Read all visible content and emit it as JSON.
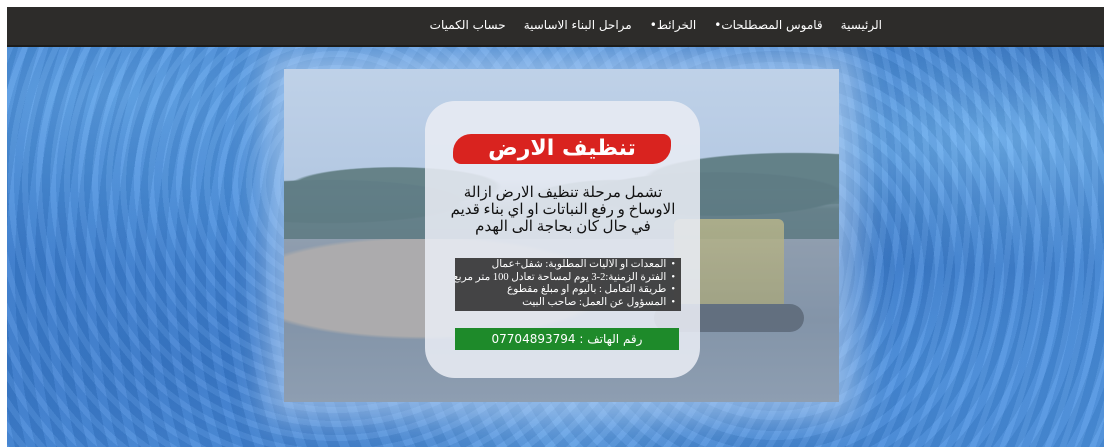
{
  "nav": {
    "items": [
      "الرئيسية",
      "•قاموس المصطلحات",
      "•الخرائط",
      "مراحل البناء الاساسية",
      "حساب الكميات"
    ]
  },
  "card": {
    "title": "تنظيف الارض",
    "description": "تشمل مرحلة تنظيف الارض ازالة الاوساخ و رفع النباتات او اي بناء قديم في حال كان بحاجة الى الهدم",
    "details": [
      "المعدات او الاليات المطلوبة: شفل+عمال",
      "الفترة الزمنية:2-3 يوم لمساحة تعادل 100 متر مربع",
      "طريقة التعامل : باليوم او مبلغ مقطوع",
      "المسؤول عن العمل: صاحب البيت"
    ],
    "phone": "رقم الهاتف : 07704893794"
  },
  "colors": {
    "navbar": "#2d2c2a",
    "title_banner": "#d9231f",
    "phone_bar": "#1e8a2a",
    "details_bg": "#2d2d2d",
    "page_bg": "#3f86d8"
  },
  "photo": {
    "subject": "bulldozer clearing land with trees in background"
  }
}
